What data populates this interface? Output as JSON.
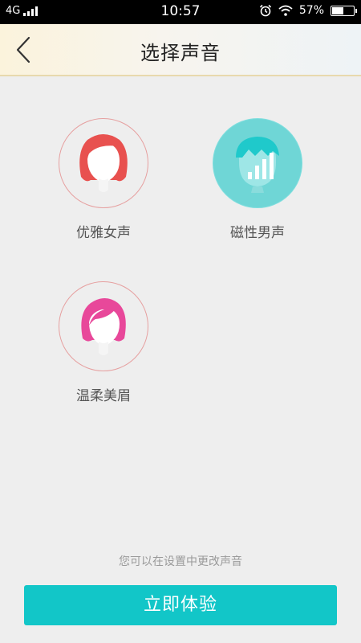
{
  "status_bar": {
    "network": "4G",
    "time": "10:57",
    "battery_text": "57%",
    "battery_level": 0.57,
    "icons": [
      "signal-icon",
      "alarm-icon",
      "wifi-icon",
      "battery-icon"
    ]
  },
  "header": {
    "title": "选择声音",
    "back_icon": "chevron-left-icon",
    "accent_border": "#e8d9ad"
  },
  "voices": [
    {
      "label": "优雅女声",
      "icon": "female-red-avatar-icon",
      "color": "#e8514f",
      "selected": false
    },
    {
      "label": "磁性男声",
      "icon": "male-avatar-playing-icon",
      "color": "#6fd6d6",
      "selected": true
    },
    {
      "label": "温柔美眉",
      "icon": "female-pink-avatar-icon",
      "color": "#e8489a",
      "selected": false
    }
  ],
  "hint": "您可以在设置中更改声音",
  "cta": {
    "label": "立即体验",
    "color": "#12c6c8"
  }
}
